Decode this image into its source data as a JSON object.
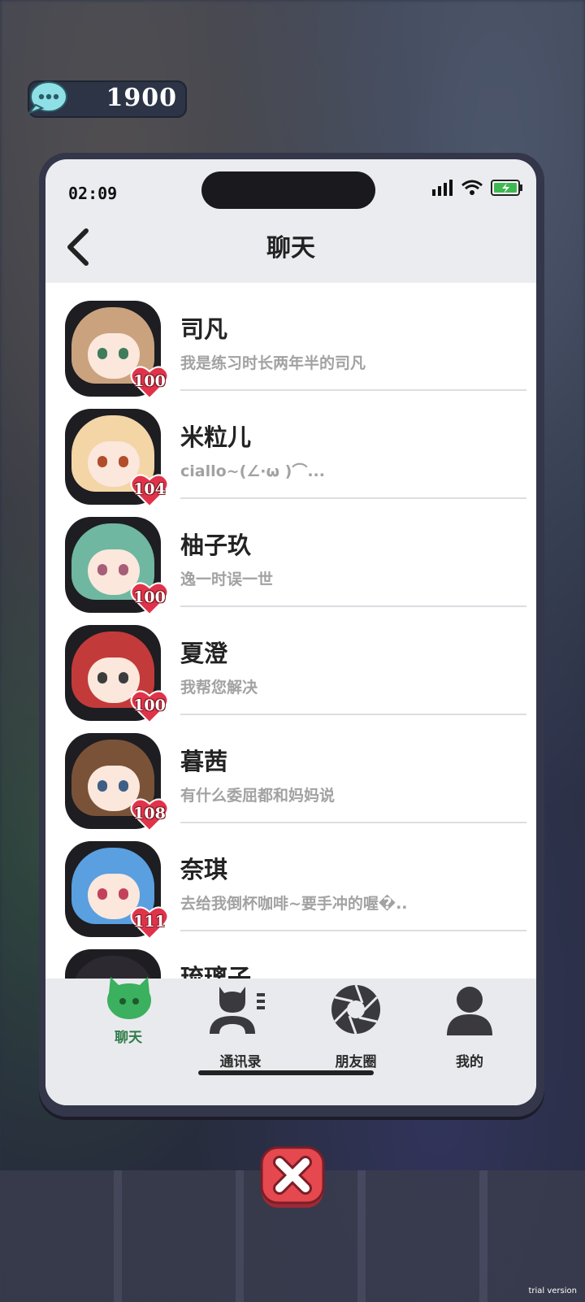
{
  "currency": {
    "value": "1900",
    "icon": "chat-bubble-icon"
  },
  "status_bar": {
    "time": "02:09"
  },
  "header": {
    "title": "聊天"
  },
  "chats": [
    {
      "name": "司凡",
      "preview": "我是练习时长两年半的司凡",
      "affection": "100",
      "hair": "#caa27e",
      "eye": "#3f7c5b"
    },
    {
      "name": "米粒儿",
      "preview": "ciallo~(∠·ω )⌒...",
      "affection": "104",
      "hair": "#f3d5a6",
      "eye": "#b24d2c"
    },
    {
      "name": "柚子玖",
      "preview": "逸一时误一世",
      "affection": "100",
      "hair": "#6fb7a0",
      "eye": "#a85d78"
    },
    {
      "name": "夏澄",
      "preview": "我帮您解决",
      "affection": "100",
      "hair": "#c33a3a",
      "eye": "#3c3c3c"
    },
    {
      "name": "暮茜",
      "preview": "有什么委屈都和妈妈说",
      "affection": "108",
      "hair": "#7a5238",
      "eye": "#3d5f86"
    },
    {
      "name": "奈琪",
      "preview": "去给我倒杯咖啡~要手冲的喔�..",
      "affection": "111",
      "hair": "#5a9fe0",
      "eye": "#c4415a"
    },
    {
      "name": "琉璃子",
      "preview": "",
      "affection": "",
      "hair": "#2c2a30",
      "eye": "#6b4b7a"
    }
  ],
  "tabs": [
    {
      "label": "聊天",
      "icon": "chat-bubble-icon",
      "active": true
    },
    {
      "label": "通讯录",
      "icon": "contacts-icon",
      "active": false
    },
    {
      "label": "朋友圈",
      "icon": "camera-aperture-icon",
      "active": false
    },
    {
      "label": "我的",
      "icon": "person-icon",
      "active": false
    }
  ],
  "colors": {
    "accent_green": "#3bb05e",
    "heart_red": "#e0334a",
    "close_red": "#e5484f"
  },
  "watermark": "trial version"
}
